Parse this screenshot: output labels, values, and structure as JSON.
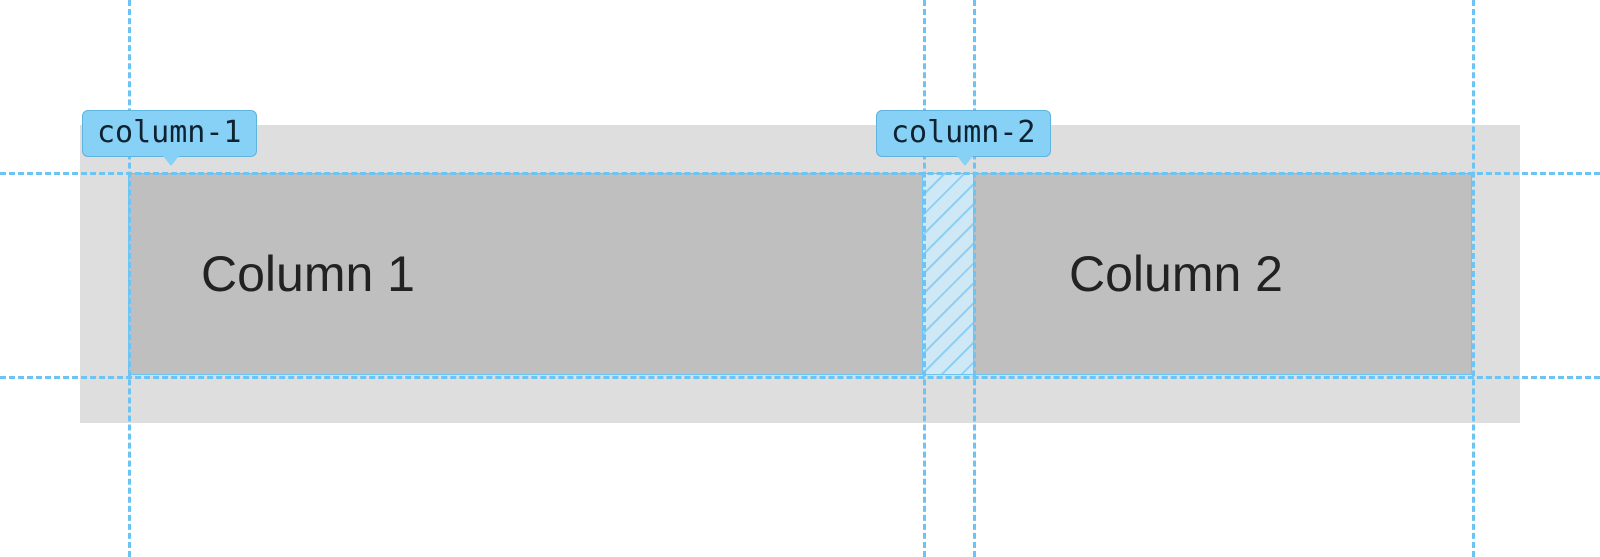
{
  "labels": {
    "col1_name": "column-1",
    "col2_name": "column-2",
    "col1_text": "Column 1",
    "col2_text": "Column 2"
  },
  "guides": {
    "horizontal": [
      172,
      376
    ],
    "vertical": [
      128,
      923,
      973,
      1472
    ]
  }
}
